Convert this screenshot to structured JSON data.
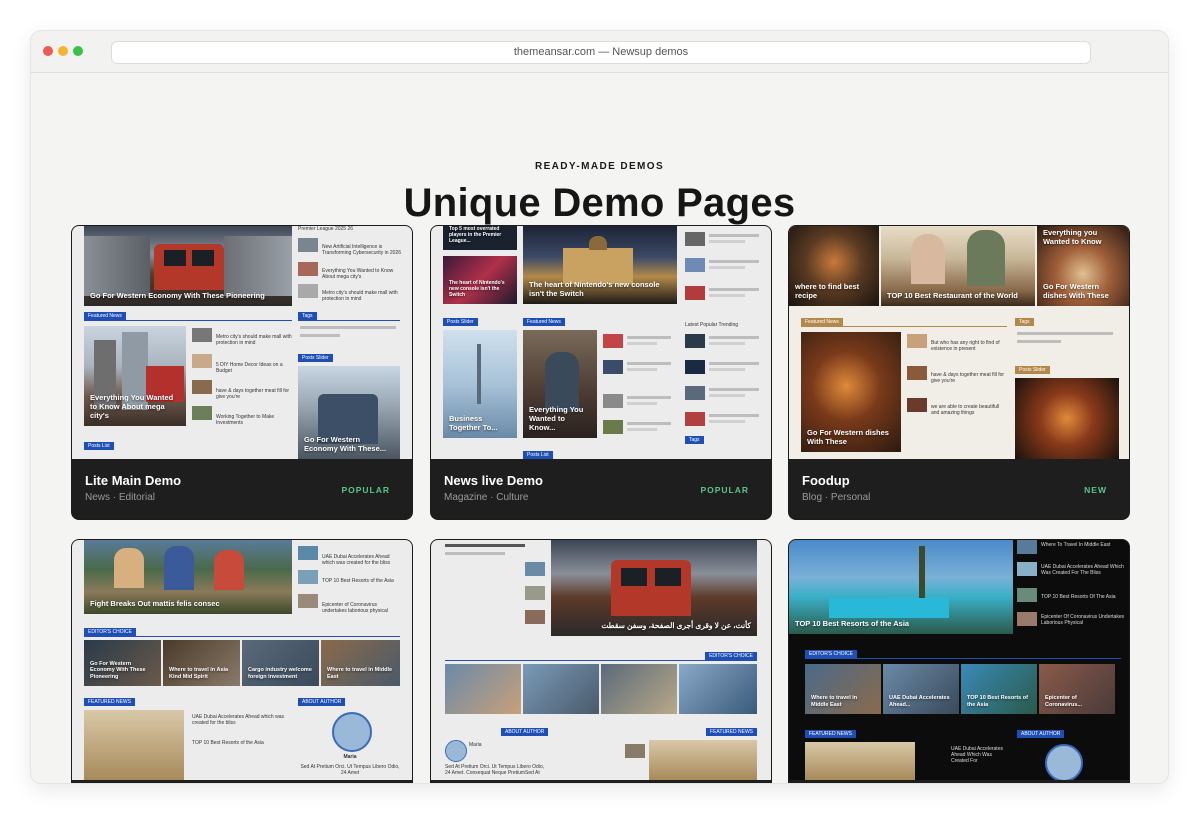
{
  "browser": {
    "url": "themeansar.com — Newsup demos"
  },
  "section": {
    "eyebrow": "READY-MADE DEMOS",
    "title": "Unique Demo Pages"
  },
  "colors": {
    "accent": "#1f4fb5",
    "badge": "#59c48a",
    "card_footer": "#1e1e1e"
  },
  "demos": [
    {
      "name": "Lite Main Demo",
      "categories": "News · Editorial",
      "badge": "POPULAR",
      "preview": {
        "hero": "Go For Western Economy With These Pioneering",
        "section1": "Featured News",
        "feature": "Everything You Wanted to Know About mega city's",
        "side1": "Premier League 2025 26",
        "side2": "New Artificial Intelligence is Transforming Cybersecurity in 2026",
        "side3": "Everything You Wanted to Know About mega city's",
        "side4": "Metro city's should make mall with protection in mind",
        "list1": "Metro city's should make mall with protection in mind",
        "list2": "5 DIY Home Decor Ideas on a Budget",
        "list3": "have & days together meat fill for give you're",
        "list4": "Working Together to Make Investments",
        "tags": "Tags",
        "slider": "Posts Slider",
        "slider_title": "Go For Western Economy With These...",
        "postlist": "Posts List"
      }
    },
    {
      "name": "News live Demo",
      "categories": "Magazine · Culture",
      "badge": "POPULAR",
      "preview": {
        "top1": "Top 5 most overrated players in the Premier League...",
        "top2": "The heart of Nintendo's new console isn't the Switch",
        "hero": "The heart of Nintendo's new console isn't the Switch",
        "slider": "Posts Slider",
        "featured": "Featured News",
        "slider_title": "Business Together To...",
        "feature": "Everything You Wanted to Know...",
        "postlist": "Posts List",
        "tags": "Tags",
        "tabs": "Latest  Popular  Trending"
      }
    },
    {
      "name": "Foodup",
      "categories": "Blog · Personal",
      "badge": "NEW",
      "preview": {
        "hero1": "where to find best recipe",
        "hero2": "TOP 10 Best Restaurant of the World",
        "hero3": "Everything you Wanted to Know",
        "hero4": "Go For Western dishes With These",
        "featured": "Featured News",
        "feature": "Go For Western dishes With These",
        "list1": "But who has any right to find of existence in present",
        "list2": "have & days together meat fill for give you're",
        "list3": "we are able to create beautifull and amazing things",
        "tags": "Tags",
        "slider": "Posts Slider"
      }
    },
    {
      "preview": {
        "hero": "Fight Breaks Out mattis felis consec",
        "side1": "UAE Dubai Accelerates Ahead which was created for the bliss",
        "side2": "TOP 10 Best Resorts of the Asia",
        "side3": "Epicenter of Coronavirus undertakes laborious physical",
        "editors": "EDITOR'S CHOICE",
        "ed1": "Go For Western Economy With These Pioneering",
        "ed2": "Where to travel in Asia Kind Mid Spirit",
        "ed3": "Cargo industry welcome foreign investment",
        "ed4": "Where to travel in Middle East",
        "featured": "FEATURED NEWS",
        "about": "ABOUT AUTHOR",
        "f1": "UAE Dubai Accelerates Ahead which was created for the bliss",
        "f2": "TOP 10 Best Resorts of the Asia",
        "author": "Maria",
        "author_bio": "Sed At Pretium Orci. Ut Tempus Libero Odio, 24 Amet"
      }
    },
    {
      "preview": {
        "hero": "كأنت، عن لا وقرى أجرى الصفحة، وسفن سقطت",
        "editors": "EDITOR'S CHOICE",
        "about": "ABOUT AUTHOR",
        "featured": "FEATURED NEWS",
        "author": "Maria",
        "author_bio": "Sed At Pretium Orci. Ut Tempus Libero Odio, 24 Amet. Consequat Neque PretiumSed At"
      }
    },
    {
      "preview": {
        "hero": "TOP 10 Best Resorts of the Asia",
        "side1": "Where To Travel In Middle East",
        "side2": "UAE Dubai Accelerates Ahead Which Was Created For The Bliss",
        "side3": "TOP 10 Best Resorts Of The Asia",
        "side4": "Epicenter Of Coronavirus Undertakes Laborious Physical",
        "editors": "EDITOR'S CHOICE",
        "ed1": "Where to travel in Middle East",
        "ed2": "UAE Dubai Accelerates Ahead...",
        "ed3": "TOP 10 Best Resorts of the Asia",
        "ed4": "Epicenter of Coronavirus...",
        "featured": "FEATURED NEWS",
        "about": "ABOUT AUTHOR",
        "f1": "UAE Dubai Accelerates Ahead Which Was Created For"
      }
    }
  ]
}
